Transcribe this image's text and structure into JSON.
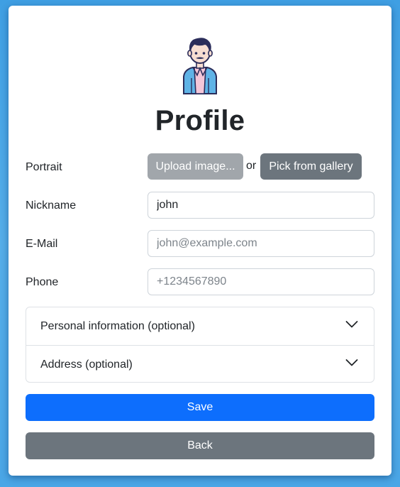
{
  "title": "Profile",
  "avatar_icon": "person-avatar-icon",
  "portrait": {
    "label": "Portrait",
    "upload_label": "Upload image...",
    "or_text": "or",
    "gallery_label": "Pick from gallery"
  },
  "nickname": {
    "label": "Nickname",
    "value": "john",
    "placeholder": ""
  },
  "email": {
    "label": "E-Mail",
    "value": "",
    "placeholder": "john@example.com"
  },
  "phone": {
    "label": "Phone",
    "value": "",
    "placeholder": "+1234567890"
  },
  "accordion": {
    "items": [
      {
        "label": "Personal information (optional)",
        "icon": "chevron-down-icon"
      },
      {
        "label": "Address (optional)",
        "icon": "chevron-down-icon"
      }
    ]
  },
  "actions": {
    "save_label": "Save",
    "back_label": "Back"
  },
  "colors": {
    "primary": "#0d6efd",
    "secondary": "#6c757d",
    "disabled": "#a1a6ab",
    "background": "#4aa6e6"
  }
}
